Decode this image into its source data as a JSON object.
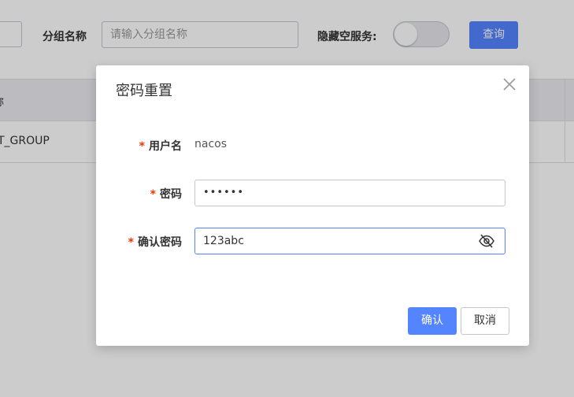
{
  "filter_bar": {
    "group_name_label": "分组名称",
    "group_name_placeholder": "请输入分组名称",
    "hide_empty_label": "隐藏空服务:",
    "hide_empty_toggle": "off",
    "query_button": "查询"
  },
  "table": {
    "header_partial": "称",
    "row_partial": "T_GROUP"
  },
  "dialog": {
    "title": "密码重置",
    "required_mark": "*",
    "username_label": "用户名",
    "username_value": "nacos",
    "password_label": "密码",
    "password_value": "••••••",
    "confirm_label": "确认密码",
    "confirm_value": "123abc",
    "ok_button": "确认",
    "cancel_button": "取消"
  },
  "icons": {
    "close": "close-icon",
    "visibility": "eye-off-icon"
  },
  "colors": {
    "primary": "#5584ff",
    "required": "#ff3000",
    "overlay": "rgba(0,0,0,0.2)"
  }
}
